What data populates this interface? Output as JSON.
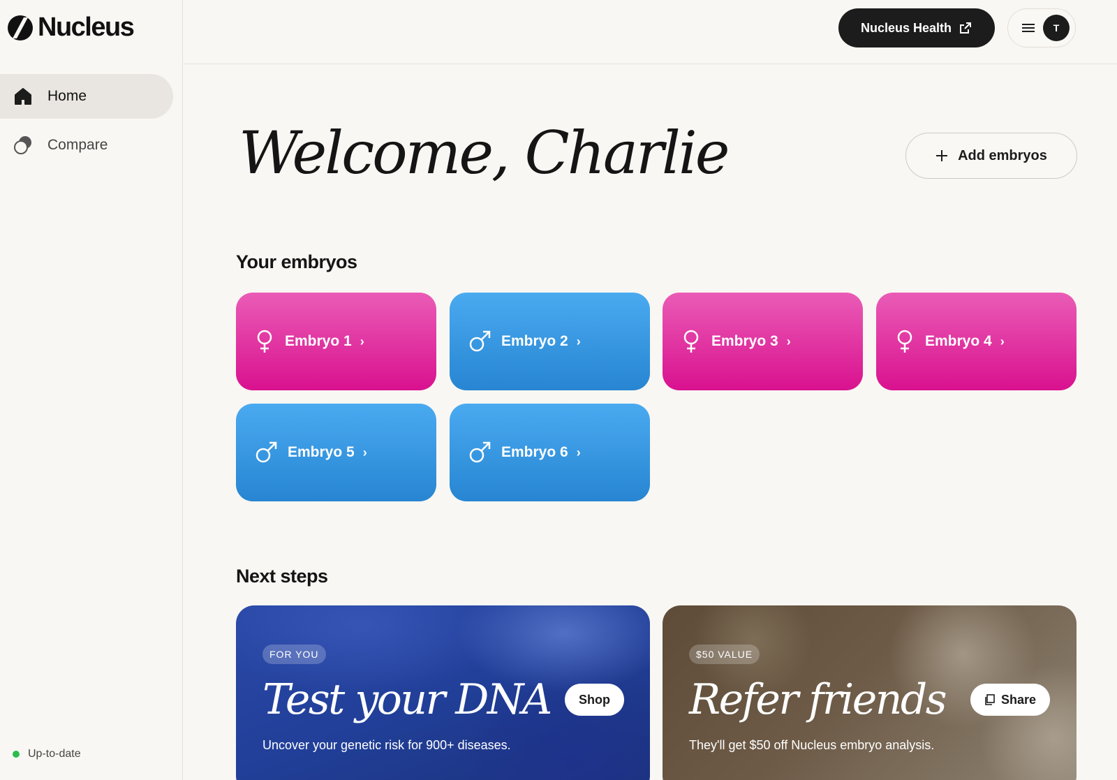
{
  "brand": {
    "name": "Nucleus"
  },
  "sidebar": {
    "items": [
      {
        "label": "Home",
        "icon": "home-icon"
      },
      {
        "label": "Compare",
        "icon": "compare-icon"
      }
    ],
    "status": {
      "label": "Up-to-date",
      "color": "#2bbd4c"
    }
  },
  "topbar": {
    "health_button": "Nucleus Health",
    "avatar_initial": "T"
  },
  "main": {
    "welcome": "Welcome, Charlie",
    "add_embryos_label": "Add embryos",
    "embryos_title": "Your embryos",
    "embryos": [
      {
        "label": "Embryo 1",
        "sex": "female"
      },
      {
        "label": "Embryo 2",
        "sex": "male"
      },
      {
        "label": "Embryo 3",
        "sex": "female"
      },
      {
        "label": "Embryo 4",
        "sex": "female"
      },
      {
        "label": "Embryo 5",
        "sex": "male"
      },
      {
        "label": "Embryo 6",
        "sex": "male"
      }
    ],
    "next_steps_title": "Next steps",
    "promos": [
      {
        "badge": "FOR YOU",
        "title": "Test your DNA",
        "subtitle": "Uncover your genetic risk for 900+ diseases.",
        "button": "Shop"
      },
      {
        "badge": "$50 VALUE",
        "title": "Refer friends",
        "subtitle": "They'll get $50 off Nucleus embryo analysis.",
        "button": "Share"
      }
    ]
  },
  "colors": {
    "female_card": "#e0239f",
    "male_card": "#3696e0",
    "dark": "#1c1c1c",
    "background": "#f9f7f3"
  }
}
